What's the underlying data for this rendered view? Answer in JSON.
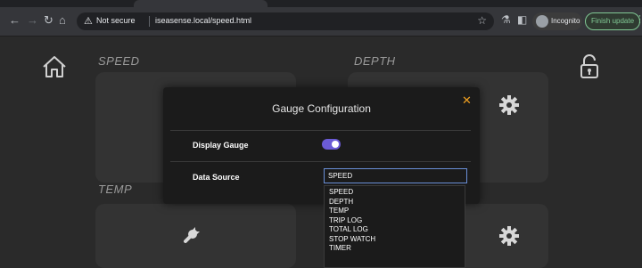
{
  "browser": {
    "security_label": "Not secure",
    "url": "iseasense.local/speed.html",
    "incognito_label": "Incognito",
    "update_button_label": "Finish update"
  },
  "dashboard": {
    "speed_label": "SPEED",
    "depth_label": "DEPTH",
    "temp_label": "TEMP"
  },
  "modal": {
    "title": "Gauge Configuration",
    "display_gauge_label": "Display Gauge",
    "display_gauge_on": true,
    "data_source_label": "Data Source",
    "data_source_value": "SPEED",
    "options": [
      "SPEED",
      "DEPTH",
      "TEMP",
      "TRIP LOG",
      "TOTAL LOG",
      "STOP WATCH",
      "TIMER"
    ]
  },
  "colors": {
    "accent": "#6b5bd6",
    "close": "#f0a020",
    "select_border": "#6a8fd8",
    "update_green": "#81c995"
  },
  "icons": [
    "back-icon",
    "forward-icon",
    "reload-icon",
    "home-icon",
    "warning-icon",
    "star-icon",
    "extensions-icon",
    "sidepanel-icon",
    "incognito-icon",
    "menu-icon",
    "lock-open-icon",
    "gear-icon",
    "wrench-icon"
  ]
}
